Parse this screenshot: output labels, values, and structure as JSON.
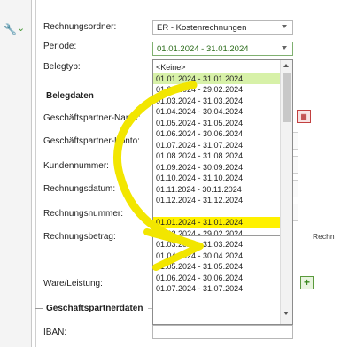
{
  "toolbar": {
    "tool_icon": "wrench-icon",
    "chevron_icon": "chevron-down-icon"
  },
  "form": {
    "rechnungsordner_label": "Rechnungsordner:",
    "rechnungsordner_value": "ER - Kostenrechnungen",
    "periode_label": "Periode:",
    "periode_value": "01.01.2024 - 31.01.2024",
    "belegtyp_label": "Belegtyp:",
    "belegdaten_title": "Belegdaten",
    "geschaeftspartner_name_label": "Geschäftspartner-Name:",
    "geschaeftspartner_konto_label": "Geschäftspartner-Konto:",
    "kundennummer_label": "Kundennummer:",
    "rechnungsdatum_label": "Rechnungsdatum:",
    "rechnungsnummer_label": "Rechnungsnummer:",
    "rechnungsbetrag_label": "Rechnungsbetrag:",
    "ware_leistung_label": "Ware/Leistung:",
    "geschaeftspartnerdaten_title": "Geschäftspartnerdaten",
    "iban_label": "IBAN:",
    "cut_text": "Rechn"
  },
  "dropdown": {
    "items": [
      "<Keine>",
      "01.01.2024 - 31.01.2024",
      "01.02.2024 - 29.02.2024",
      "01.03.2024 - 31.03.2024",
      "01.04.2024 - 30.04.2024",
      "01.05.2024 - 31.05.2024",
      "01.06.2024 - 30.06.2024",
      "01.07.2024 - 31.07.2024",
      "01.08.2024 - 31.08.2024",
      "01.09.2024 - 30.09.2024",
      "01.10.2024 - 31.10.2024",
      "01.11.2024 - 30.11.2024",
      "01.12.2024 - 31.12.2024",
      "",
      "01.01.2024 - 31.01.2024",
      "01.02.2024 - 29.02.2024",
      "01.03.2024 - 31.03.2024",
      "01.04.2024 - 30.04.2024",
      "01.05.2024 - 31.05.2024",
      "01.06.2024 - 30.06.2024",
      "01.07.2024 - 31.07.2024"
    ],
    "selected_index": 1,
    "highlighted_index": 14
  },
  "colors": {
    "annotation_arrow": "#f2e600",
    "selected_item": "#d7f1a8",
    "highlight_item": "#fff100",
    "accent_green": "#4a9a3a"
  }
}
